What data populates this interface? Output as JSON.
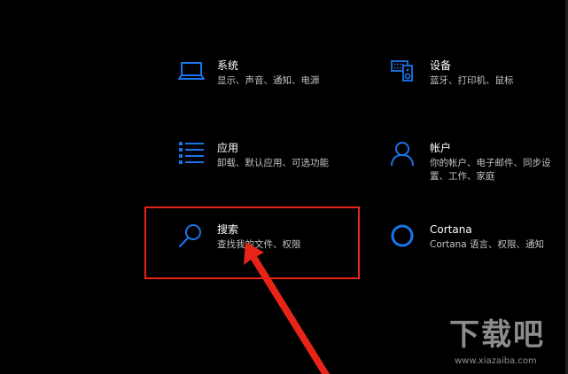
{
  "colors": {
    "background": "#000000",
    "accent": "#1a73e8",
    "title_text": "#ffffff",
    "desc_text": "#c2c2c2",
    "highlight": "#e82419"
  },
  "settings": {
    "system": {
      "title": "系统",
      "desc": [
        "显示、声音、通知、电源"
      ],
      "icon": "laptop-icon"
    },
    "devices": {
      "title": "设备",
      "desc": [
        "蓝牙、打印机、鼠标"
      ],
      "icon": "keyboard-speaker-icon"
    },
    "apps": {
      "title": "应用",
      "desc": [
        "卸载、默认应用、可选功能"
      ],
      "icon": "app-list-icon"
    },
    "accounts": {
      "title": "帐户",
      "desc": [
        "你的帐户、电子邮件、同步设",
        "置、工作、家庭"
      ],
      "icon": "person-icon"
    },
    "search": {
      "title": "搜索",
      "desc": [
        "查找我的文件、权限"
      ],
      "icon": "magnifier-icon"
    },
    "cortana": {
      "title": "Cortana",
      "desc": [
        "Cortana 语言、权限、通知"
      ],
      "icon": "cortana-circle-icon"
    }
  },
  "annotation": {
    "highlighted_item": "search",
    "arrow": "red-arrow"
  },
  "watermark": {
    "main": "下载吧",
    "url": "www.xiazaiba.com"
  }
}
